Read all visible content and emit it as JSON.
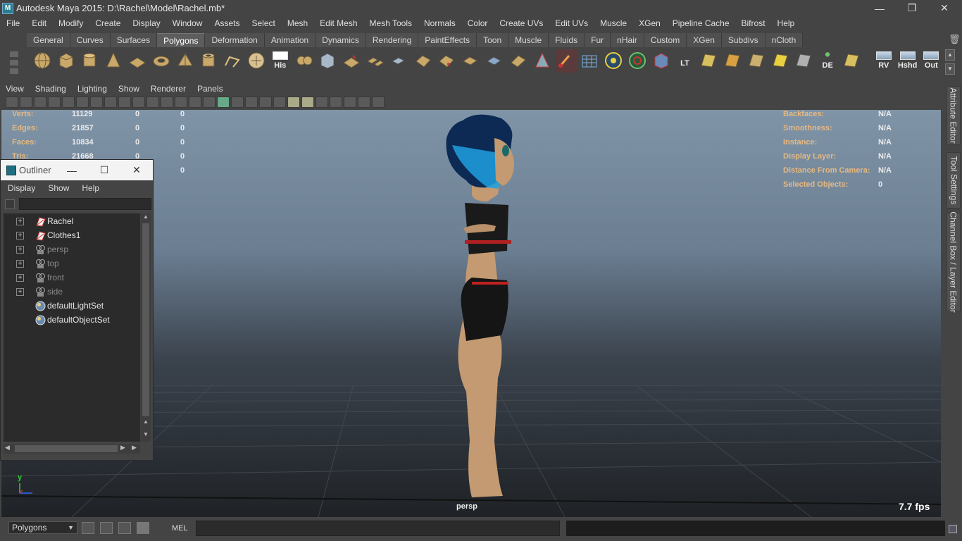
{
  "window": {
    "title": "Autodesk Maya 2015: D:\\Rachel\\Model\\Rachel.mb*",
    "minimize": "—",
    "restore": "❐",
    "close": "✕"
  },
  "menubar": [
    "File",
    "Edit",
    "Modify",
    "Create",
    "Display",
    "Window",
    "Assets",
    "Select",
    "Mesh",
    "Edit Mesh",
    "Mesh Tools",
    "Normals",
    "Color",
    "Create UVs",
    "Edit UVs",
    "Muscle",
    "XGen",
    "Pipeline Cache",
    "Bifrost",
    "Help"
  ],
  "shelf": {
    "tabs": [
      "General",
      "Curves",
      "Surfaces",
      "Polygons",
      "Deformation",
      "Animation",
      "Dynamics",
      "Rendering",
      "PaintEffects",
      "Toon",
      "Muscle",
      "Fluids",
      "Fur",
      "nHair",
      "Custom",
      "XGen",
      "Subdivs",
      "nCloth"
    ],
    "active_tab": "Polygons",
    "icon_labels": {
      "his": "His",
      "lt": "LT",
      "de": "DE",
      "rv": "RV",
      "hshd": "Hshd",
      "out": "Out"
    }
  },
  "viewport": {
    "menu": [
      "View",
      "Shading",
      "Lighting",
      "Show",
      "Renderer",
      "Panels"
    ],
    "hud_left": [
      {
        "label": "Verts:",
        "v1": "11129",
        "v2": "0",
        "v3": "0"
      },
      {
        "label": "Edges:",
        "v1": "21857",
        "v2": "0",
        "v3": "0"
      },
      {
        "label": "Faces:",
        "v1": "10834",
        "v2": "0",
        "v3": "0"
      },
      {
        "label": "Tris:",
        "v1": "21668",
        "v2": "0",
        "v3": "0"
      },
      {
        "label": "",
        "v1": "",
        "v2": "",
        "v3": "0"
      }
    ],
    "hud_right": [
      {
        "label": "Backfaces:",
        "value": "N/A"
      },
      {
        "label": "Smoothness:",
        "value": "N/A"
      },
      {
        "label": "Instance:",
        "value": "N/A"
      },
      {
        "label": "Display Layer:",
        "value": "N/A"
      },
      {
        "label": "Distance From Camera:",
        "value": "N/A"
      },
      {
        "label": "Selected Objects:",
        "value": "0"
      }
    ],
    "camera_label": "persp",
    "fps": "7.7 fps",
    "axis_y": "y"
  },
  "outliner": {
    "title": "Outliner",
    "menu": [
      "Display",
      "Show",
      "Help"
    ],
    "items": [
      {
        "name": "Rachel",
        "type": "mesh",
        "expandable": true,
        "dim": false
      },
      {
        "name": "Clothes1",
        "type": "mesh",
        "expandable": true,
        "dim": false
      },
      {
        "name": "persp",
        "type": "camera",
        "expandable": true,
        "dim": true
      },
      {
        "name": "top",
        "type": "camera",
        "expandable": true,
        "dim": true
      },
      {
        "name": "front",
        "type": "camera",
        "expandable": true,
        "dim": true
      },
      {
        "name": "side",
        "type": "camera",
        "expandable": true,
        "dim": true
      },
      {
        "name": "defaultLightSet",
        "type": "set",
        "expandable": false,
        "dim": false
      },
      {
        "name": "defaultObjectSet",
        "type": "set",
        "expandable": false,
        "dim": false
      }
    ]
  },
  "bottombar": {
    "mode": "Polygons",
    "mel_label": "MEL"
  },
  "right_tabs": [
    "Attribute Editor",
    "Tool Settings",
    "Channel Box / Layer Editor"
  ]
}
